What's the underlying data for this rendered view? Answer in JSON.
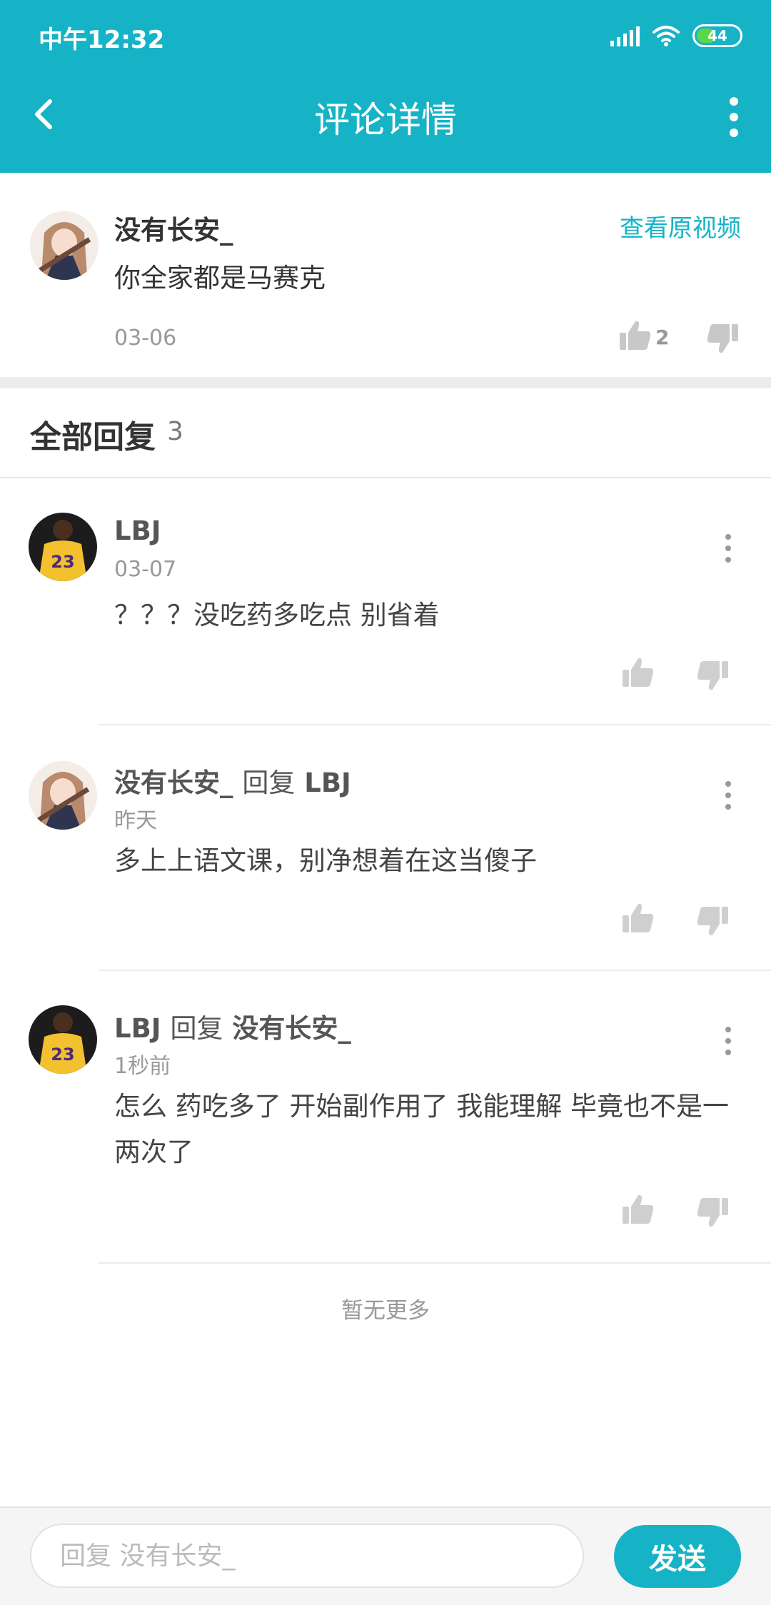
{
  "status_bar": {
    "time": "中午12:32",
    "battery": "44"
  },
  "app_bar": {
    "title": "评论详情"
  },
  "main_comment": {
    "author": "没有长安_",
    "view_original": "查看原视频",
    "text": "你全家都是马赛克",
    "date": "03-06",
    "likes": "2"
  },
  "replies_header": {
    "label": "全部回复",
    "count": "3"
  },
  "replies": [
    {
      "author": "LBJ",
      "reply_word": "",
      "target": "",
      "date": "03-07",
      "text": "？？？没吃药多吃点 别省着"
    },
    {
      "author": "没有长安_",
      "reply_word": "回复",
      "target": "LBJ",
      "date": "昨天",
      "text": "多上上语文课，别净想着在这当傻子"
    },
    {
      "author": "LBJ",
      "reply_word": "回复",
      "target": "没有长安_",
      "date": "1秒前",
      "text": "怎么 药吃多了 开始副作用了 我能理解 毕竟也不是一两次了"
    }
  ],
  "footer": {
    "no_more": "暂无更多"
  },
  "input": {
    "placeholder": "回复 没有长安_",
    "value": ""
  },
  "send_button": {
    "label": "发送"
  },
  "colors": {
    "accent": "#16b3c7",
    "icon_gray": "#c8c8c8",
    "divider": "#ececec"
  },
  "icons": [
    "back-arrow-icon",
    "more-vertical-icon",
    "thumbs-up-icon",
    "thumbs-down-icon",
    "kebab-icon",
    "signal-icon",
    "wifi-icon",
    "battery-icon"
  ]
}
